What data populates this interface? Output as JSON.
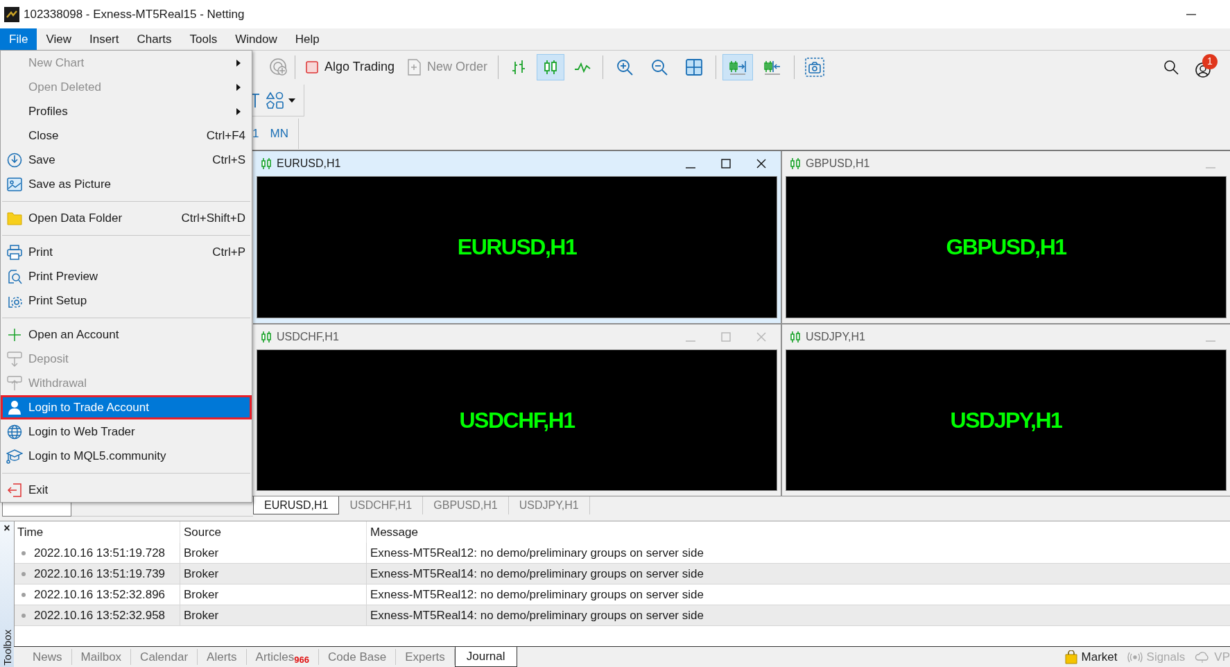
{
  "window": {
    "title": "102338098 - Exness-MT5Real15 - Netting"
  },
  "menu_bar": [
    {
      "label": "File",
      "selected": true
    },
    {
      "label": "View",
      "selected": false
    },
    {
      "label": "Insert",
      "selected": false
    },
    {
      "label": "Charts",
      "selected": false
    },
    {
      "label": "Tools",
      "selected": false
    },
    {
      "label": "Window",
      "selected": false
    },
    {
      "label": "Help",
      "selected": false
    }
  ],
  "file_menu": {
    "groups": [
      [
        {
          "label": "New Chart",
          "submenu": true,
          "disabled": true,
          "selected": false
        },
        {
          "label": "Open Deleted",
          "submenu": true,
          "disabled": true,
          "selected": false
        },
        {
          "label": "Profiles",
          "submenu": true,
          "disabled": false,
          "selected": false
        },
        {
          "label": "Close",
          "shortcut": "Ctrl+F4",
          "disabled": false,
          "selected": false
        },
        {
          "label": "Save",
          "shortcut": "Ctrl+S",
          "disabled": false,
          "selected": false
        },
        {
          "label": "Save as Picture",
          "disabled": false,
          "selected": false
        }
      ],
      [
        {
          "label": "Open Data Folder",
          "shortcut": "Ctrl+Shift+D",
          "disabled": false,
          "selected": false
        }
      ],
      [
        {
          "label": "Print",
          "shortcut": "Ctrl+P",
          "disabled": false,
          "selected": false
        },
        {
          "label": "Print Preview",
          "disabled": false,
          "selected": false
        },
        {
          "label": "Print Setup",
          "disabled": false,
          "selected": false
        }
      ],
      [
        {
          "label": "Open an Account",
          "disabled": false,
          "selected": false
        },
        {
          "label": "Deposit",
          "disabled": true,
          "selected": false
        },
        {
          "label": "Withdrawal",
          "disabled": true,
          "selected": false
        },
        {
          "label": "Login to Trade Account",
          "disabled": false,
          "selected": true
        },
        {
          "label": "Login to Web Trader",
          "disabled": false,
          "selected": false
        },
        {
          "label": "Login to MQL5.community",
          "disabled": false,
          "selected": false
        }
      ],
      [
        {
          "label": "Exit",
          "disabled": false,
          "selected": false
        }
      ]
    ]
  },
  "toolbar": {
    "algo_trading": {
      "label": "Algo Trading"
    },
    "new_order": {
      "label": "New Order",
      "disabled": true
    },
    "chart_buttons": [
      {
        "selected": false
      },
      {
        "selected": true
      },
      {
        "selected": false
      }
    ],
    "view_buttons": [
      {
        "selected": false
      },
      {
        "selected": false
      },
      {
        "selected": false
      },
      {
        "selected": true
      },
      {
        "selected": false
      }
    ],
    "notifications": "1"
  },
  "timeframes": [
    {
      "label": "1"
    },
    {
      "label": "MN"
    }
  ],
  "charts": [
    {
      "title": "EURUSD,H1",
      "label": "EURUSD,H1",
      "active": true,
      "controls": [
        {
          "kind": "minimize"
        },
        {
          "kind": "maximize"
        },
        {
          "kind": "close"
        }
      ]
    },
    {
      "title": "GBPUSD,H1",
      "label": "GBPUSD,H1",
      "active": false,
      "controls": [
        {
          "kind": "minimize"
        }
      ]
    },
    {
      "title": "USDCHF,H1",
      "label": "USDCHF,H1",
      "active": false,
      "controls": [
        {
          "kind": "minimize"
        },
        {
          "kind": "maximize"
        },
        {
          "kind": "close"
        }
      ]
    },
    {
      "title": "USDJPY,H1",
      "label": "USDJPY,H1",
      "active": false,
      "controls": [
        {
          "kind": "minimize"
        }
      ]
    }
  ],
  "chart_tabs": [
    {
      "label": "EURUSD,H1",
      "selected": true
    },
    {
      "label": "USDCHF,H1",
      "selected": false
    },
    {
      "label": "GBPUSD,H1",
      "selected": false
    },
    {
      "label": "USDJPY,H1",
      "selected": false
    }
  ],
  "toolbox": {
    "title": "Toolbox",
    "close": "×",
    "columns": [
      "Time",
      "Source",
      "Message"
    ],
    "rows": [
      {
        "time": "2022.10.16 13:51:19.728",
        "source": "Broker",
        "message": "Exness-MT5Real12: no demo/preliminary groups on server side"
      },
      {
        "time": "2022.10.16 13:51:19.739",
        "source": "Broker",
        "message": "Exness-MT5Real14: no demo/preliminary groups on server side"
      },
      {
        "time": "2022.10.16 13:52:32.896",
        "source": "Broker",
        "message": "Exness-MT5Real12: no demo/preliminary groups on server side"
      },
      {
        "time": "2022.10.16 13:52:32.958",
        "source": "Broker",
        "message": "Exness-MT5Real14: no demo/preliminary groups on server side"
      }
    ],
    "tabs": [
      {
        "label": "News",
        "selected": false
      },
      {
        "label": "Mailbox",
        "selected": false
      },
      {
        "label": "Calendar",
        "selected": false
      },
      {
        "label": "Alerts",
        "selected": false
      },
      {
        "label": "Articles",
        "badge": "966",
        "selected": false
      },
      {
        "label": "Code Base",
        "selected": false
      },
      {
        "label": "Experts",
        "selected": false
      },
      {
        "label": "Journal",
        "selected": true
      }
    ],
    "services": [
      {
        "label": "Market",
        "disabled": false
      },
      {
        "label": "Signals",
        "disabled": true
      },
      {
        "label": "VP",
        "disabled": true
      }
    ]
  }
}
